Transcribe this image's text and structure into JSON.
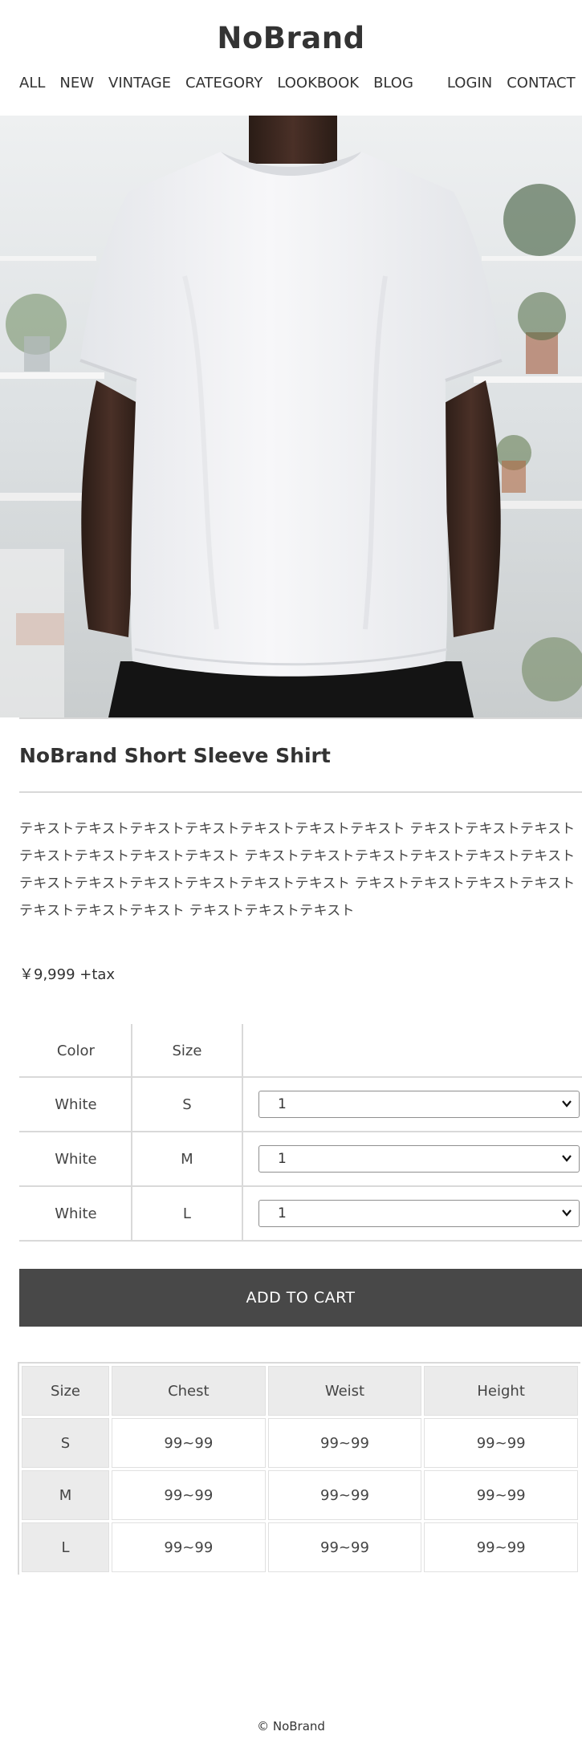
{
  "header": {
    "brand": "NoBrand",
    "nav": [
      "ALL",
      "NEW",
      "VINTAGE",
      "CATEGORY",
      "LOOKBOOK",
      "BLOG",
      "LOGIN",
      "CONTACT"
    ]
  },
  "product": {
    "title": "NoBrand Short Sleeve Shirt",
    "description": "テキストテキストテキストテキストテキストテキストテキスト テキストテキストテキストテキストテキストテキストテキスト テキストテキストテキストテキストテキストテキスト テキストテキストテキストテキストテキストテキスト テキストテキストテキストテキストテキストテキストテキスト テキストテキストテキスト",
    "price": "￥9,999 +tax"
  },
  "variants": {
    "headers": [
      "Color",
      "Size",
      ""
    ],
    "rows": [
      {
        "color": "White",
        "size": "S",
        "qty": "1"
      },
      {
        "color": "White",
        "size": "M",
        "qty": "1"
      },
      {
        "color": "White",
        "size": "L",
        "qty": "1"
      }
    ]
  },
  "cart": {
    "label": "ADD TO CART"
  },
  "size_chart": {
    "headers": [
      "Size",
      "Chest",
      "Weist",
      "Height"
    ],
    "rows": [
      {
        "size": "S",
        "chest": "99~99",
        "weist": "99~99",
        "height": "99~99"
      },
      {
        "size": "M",
        "chest": "99~99",
        "weist": "99~99",
        "height": "99~99"
      },
      {
        "size": "L",
        "chest": "99~99",
        "weist": "99~99",
        "height": "99~99"
      }
    ]
  },
  "footer": {
    "copyright": "© NoBrand"
  },
  "colors": {
    "button": "#484848",
    "divider": "#d9d9d9",
    "table_header": "#ebebeb"
  }
}
